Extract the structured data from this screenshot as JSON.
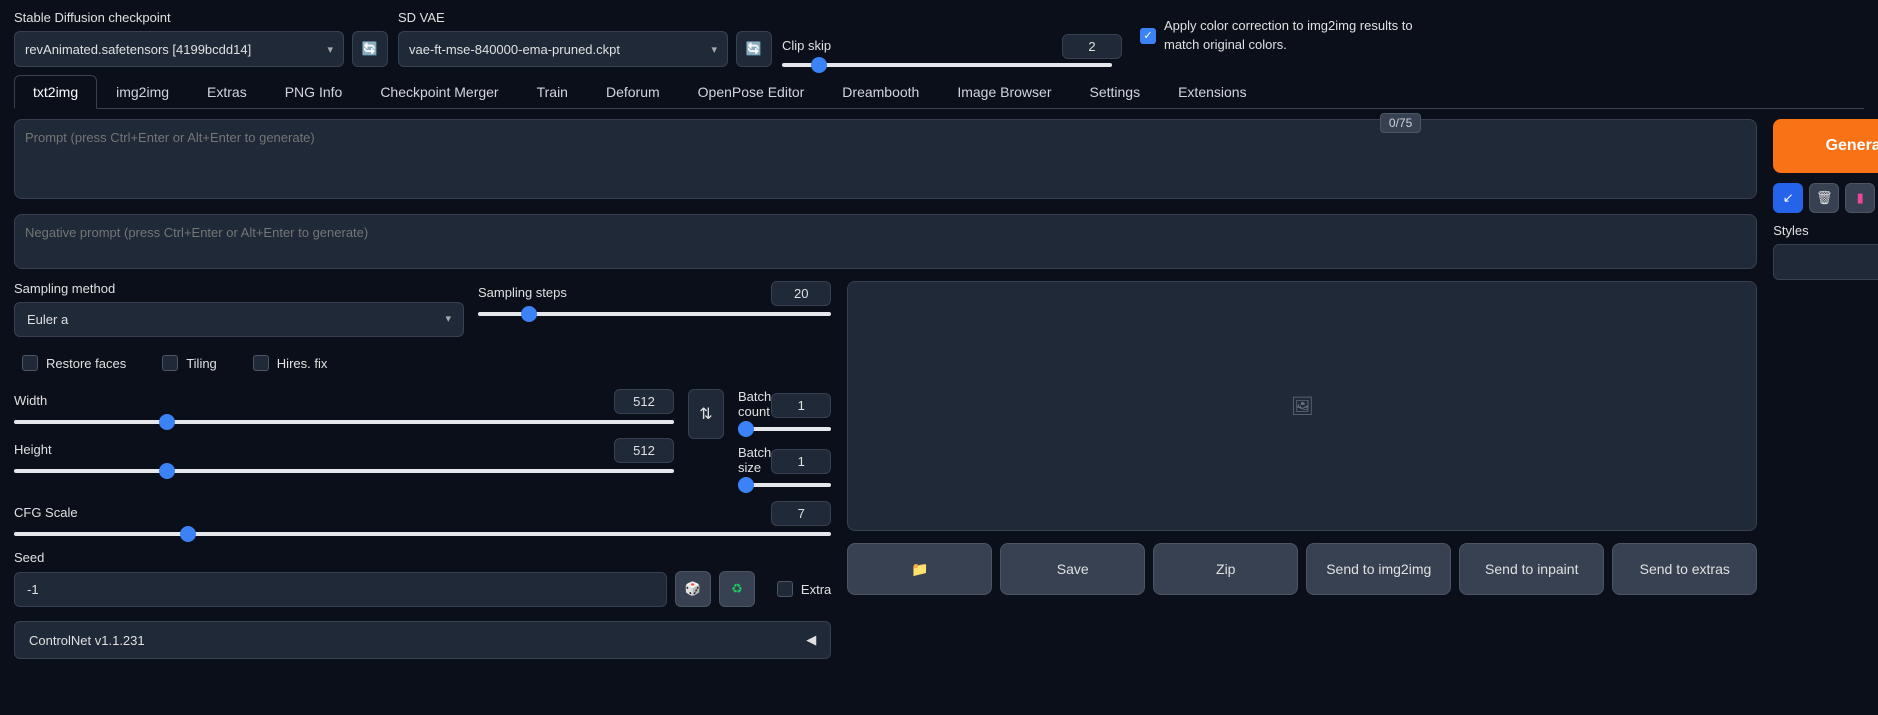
{
  "top": {
    "checkpoint_label": "Stable Diffusion checkpoint",
    "checkpoint_value": "revAnimated.safetensors [4199bcdd14]",
    "vae_label": "SD VAE",
    "vae_value": "vae-ft-mse-840000-ema-pruned.ckpt",
    "clip_skip_label": "Clip skip",
    "clip_skip_value": "2",
    "color_correct_label": "Apply color correction to img2img results to match original colors."
  },
  "tabs": [
    "txt2img",
    "img2img",
    "Extras",
    "PNG Info",
    "Checkpoint Merger",
    "Train",
    "Deforum",
    "OpenPose Editor",
    "Dreambooth",
    "Image Browser",
    "Settings",
    "Extensions"
  ],
  "active_tab": "txt2img",
  "prompts": {
    "main_placeholder": "Prompt (press Ctrl+Enter or Alt+Enter to generate)",
    "neg_placeholder": "Negative prompt (press Ctrl+Enter or Alt+Enter to generate)",
    "token_counter": "0/75"
  },
  "right": {
    "generate": "Generate",
    "styles_label": "Styles"
  },
  "params": {
    "sampling_method_label": "Sampling method",
    "sampling_method_value": "Euler a",
    "sampling_steps_label": "Sampling steps",
    "sampling_steps_value": "20",
    "restore_faces": "Restore faces",
    "tiling": "Tiling",
    "hires_fix": "Hires. fix",
    "width_label": "Width",
    "width_value": "512",
    "height_label": "Height",
    "height_value": "512",
    "batch_count_label": "Batch count",
    "batch_count_value": "1",
    "batch_size_label": "Batch size",
    "batch_size_value": "1",
    "cfg_label": "CFG Scale",
    "cfg_value": "7",
    "seed_label": "Seed",
    "seed_value": "-1",
    "extra_label": "Extra",
    "controlnet_label": "ControlNet v1.1.231"
  },
  "output": {
    "save": "Save",
    "zip": "Zip",
    "send_img2img": "Send to img2img",
    "send_inpaint": "Send to inpaint",
    "send_extras": "Send to extras"
  }
}
